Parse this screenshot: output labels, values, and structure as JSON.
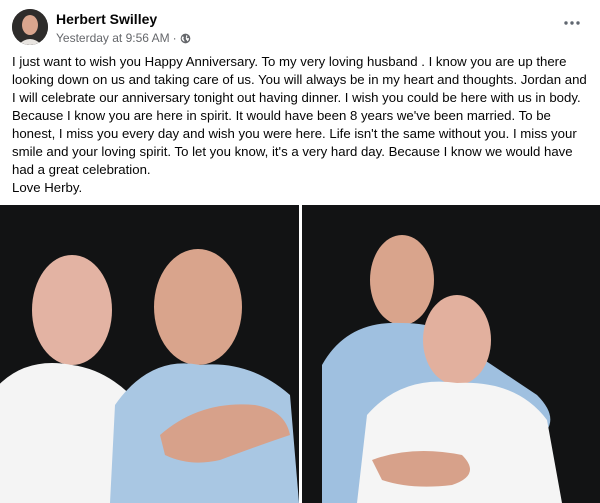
{
  "post": {
    "author": "Herbert Swilley",
    "timestamp": "Yesterday at 9:56 AM",
    "separator": "·",
    "audience_icon": "globe-icon",
    "menu_icon": "more-options-icon",
    "paragraphs": [
      "I just want to wish you Happy Anniversary. To my very loving husband . I know you are up there looking down on us and taking care of us. You will always be in my heart and thoughts. Jordan and I will celebrate our anniversary tonight out having dinner. I wish you could be here with us in body. Because I know you are here in spirit. It would have been 8 years we've been married. To be honest, I miss you every day and wish you were here. Life isn't the same without you. I miss your smile and your loving spirit. To let you know, it's a very hard day. Because I know we would have had a great celebration.",
      "Love Herby."
    ]
  },
  "colors": {
    "author": "#050505",
    "meta": "#65676b",
    "photo_background": "#121314"
  }
}
